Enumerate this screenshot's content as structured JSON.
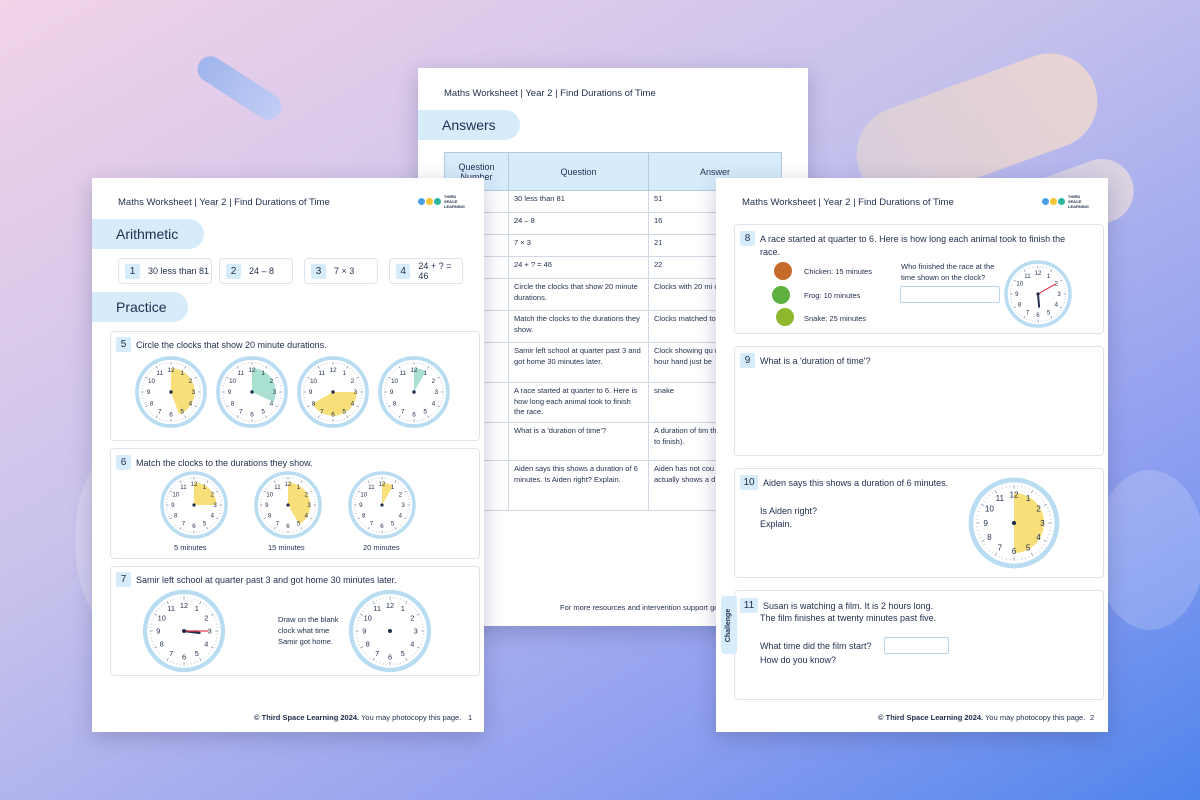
{
  "header": "Maths Worksheet | Year 2 | Find Durations of Time",
  "logo": {
    "line1": "THIRD SPACE",
    "line2": "LEARNING",
    "colors": [
      "#4a9fe0",
      "#f5c431",
      "#2cb7a3"
    ]
  },
  "colors": {
    "pill": "#d6ecfb",
    "clock_ring": "#b8dcf2",
    "sector_yellow": "#f8df7a",
    "sector_teal": "#a9e0d2",
    "hand": "#1f2d4d",
    "minute_red": "#e03a4a"
  },
  "clock_numbers": [
    "12",
    "1",
    "2",
    "3",
    "4",
    "5",
    "6",
    "7",
    "8",
    "9",
    "10",
    "11"
  ],
  "answers_sheet": {
    "title": "Answers",
    "columns": [
      "Question Number",
      "Question",
      "Answer"
    ],
    "rows": [
      {
        "num": "",
        "q": "30 less than 81",
        "a": "51"
      },
      {
        "num": "",
        "q": "24 – 8",
        "a": "16"
      },
      {
        "num": "",
        "q": "7 × 3",
        "a": "21"
      },
      {
        "num": "",
        "q": "24 + ? = 46",
        "a": "22"
      },
      {
        "num": "",
        "q": "Circle the clocks that show 20 minute durations.",
        "a": "Clocks with 20 mi circled."
      },
      {
        "num": "",
        "q": "Match the clocks to the durations they show.",
        "a": "Clocks matched to"
      },
      {
        "num": "",
        "q": "Samir left school at quarter past 3 and got home 30 minutes later.",
        "a": "Clock showing qu minute hand poin hour hand just be"
      },
      {
        "num": "",
        "q": "A race started at quarter to 6. Here is how long each animal took to finish the race.",
        "a": "snake"
      },
      {
        "num": "",
        "q": "What is a 'duration of time'?",
        "a": "A duration of tim there is during an to finish)."
      },
      {
        "num": "",
        "q": "Aiden says this shows a duration of 6 minutes. Is Aiden right? Explain.",
        "a": "Aiden has not cou calculate the dura actually shows a d minutes."
      }
    ],
    "footer": "For more resources and intervention support go to"
  },
  "page1": {
    "arithmetic_title": "Arithmetic",
    "arithmetic": [
      {
        "num": "1",
        "text": "30 less than 81"
      },
      {
        "num": "2",
        "text": "24 – 8"
      },
      {
        "num": "3",
        "text": "7 × 3"
      },
      {
        "num": "4",
        "text": "24 + ? = 46"
      }
    ],
    "practice_title": "Practice",
    "q5": {
      "num": "5",
      "text": "Circle the clocks that show 20 minute durations."
    },
    "q6": {
      "num": "6",
      "text": "Match the clocks to the durations they show.",
      "labels": [
        "5 minutes",
        "15 minutes",
        "20 minutes"
      ]
    },
    "q7": {
      "num": "7",
      "text": "Samir left school at quarter past 3 and got home 30 minutes later.",
      "instruction": [
        "Draw on the blank",
        "clock what time",
        "Samir got home."
      ]
    },
    "footer_bold": "© Third Space Learning 2024.",
    "footer_rest": " You may photocopy this page.",
    "page_number": "1"
  },
  "page2": {
    "q8": {
      "num": "8",
      "line1": "A race started at quarter to 6. Here is how long each animal took to finish the",
      "line2": "race.",
      "animals": [
        {
          "name": "Chicken: 15 minutes"
        },
        {
          "name": "Frog: 10 minutes"
        },
        {
          "name": "Snake: 25 minutes"
        }
      ],
      "question": [
        "Who finished the race at the",
        "time shown on the clock?"
      ]
    },
    "q9": {
      "num": "9",
      "text": "What is a 'duration of time'?"
    },
    "q10": {
      "num": "10",
      "text": "Aiden says this shows a duration of 6 minutes.",
      "lines": [
        "Is Aiden right?",
        "Explain."
      ]
    },
    "q11": {
      "num": "11",
      "line1": "Susan is watching a film. It is 2 hours long.",
      "line2": "The film finishes at twenty minutes past five.",
      "line3": "What time did the film start?",
      "line4": "How do you know?",
      "tag": "Challenge"
    },
    "footer_bold": "© Third Space Learning 2024.",
    "footer_rest": " You may photocopy this page.",
    "page_number": "2"
  }
}
